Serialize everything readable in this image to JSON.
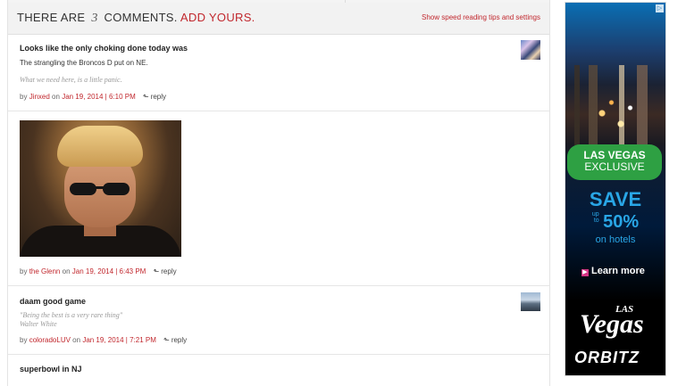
{
  "header": {
    "prefix": "THERE ARE",
    "count": "3",
    "suffix": "COMMENTS.",
    "add_link": "ADD YOURS.",
    "tips_link": "Show speed reading tips and settings"
  },
  "comments": [
    {
      "title": "Looks like the only choking done today was",
      "body": "The strangling the Broncos D put on NE.",
      "quote": "What we need here, is a little panic.",
      "by": "by",
      "author": "Jinxed",
      "on": "on",
      "date": "Jan 19, 2014 | 6:10 PM",
      "reply": "reply"
    },
    {
      "by": "by",
      "author": "the Glenn",
      "on": "on",
      "date": "Jan 19, 2014 | 6:43 PM",
      "reply": "reply"
    },
    {
      "title": "daam good game",
      "quote": "\"Being the best is a very rare thing\"",
      "quote_author": "Walter White",
      "by": "by",
      "author": "coloradoLUV",
      "on": "on",
      "date": "Jan 19, 2014 | 7:21 PM",
      "reply": "reply"
    },
    {
      "title": "superbowl in NJ"
    }
  ],
  "ad": {
    "choices_icon": "▷",
    "exclusive_line1": "LAS VEGAS",
    "exclusive_line2": "EXCLUSIVE",
    "save": "SAVE",
    "upto_line1": "up",
    "upto_line2": "to",
    "percent": "50%",
    "on_hotels": "on hotels",
    "learn_more": "Learn more",
    "las": "LAS",
    "vegas": "Vegas",
    "brand": "ORBITZ"
  },
  "icons": {
    "reply": "reply-arrow-icon",
    "learn_arrow": "play-arrow-icon"
  },
  "colors": {
    "accent": "#c1272d",
    "ad_green": "#2ea043",
    "ad_blue": "#29a6e6"
  }
}
